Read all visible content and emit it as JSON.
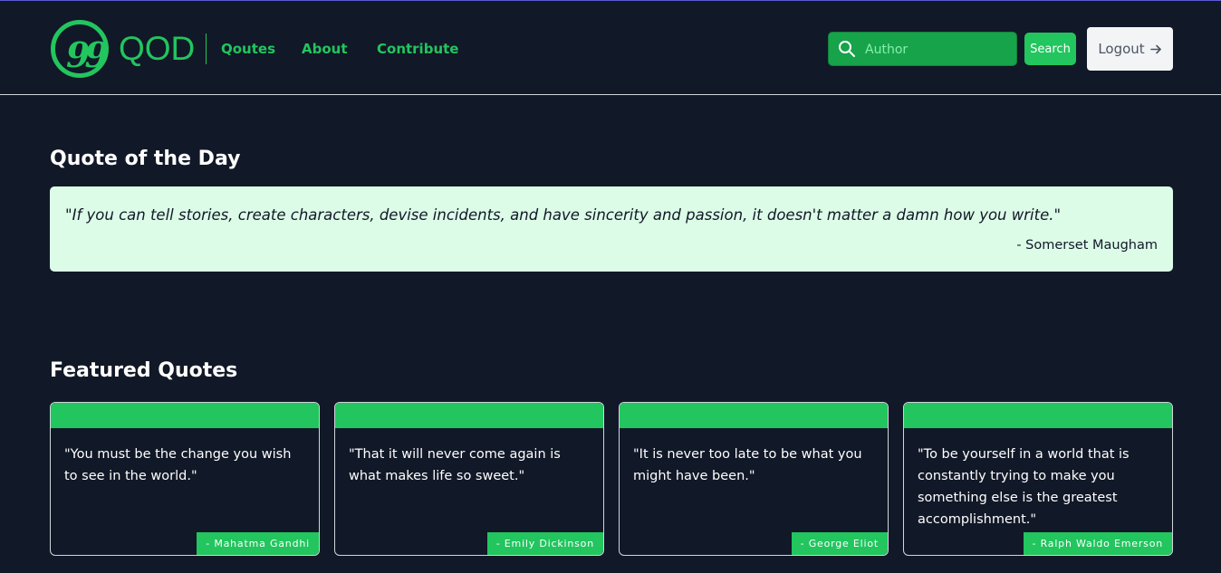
{
  "brand": {
    "name": "QOD",
    "logo_glyph": "99"
  },
  "nav": [
    {
      "label": "Qoutes"
    },
    {
      "label": "About"
    },
    {
      "label": "Contribute"
    }
  ],
  "search": {
    "placeholder": "Author",
    "value": "",
    "button_label": "Search"
  },
  "logout": {
    "label": "Logout",
    "icon": "arrow-right-icon"
  },
  "qotd": {
    "heading": "Quote of the Day",
    "quote": "\"If you can tell stories, create characters, devise incidents, and have sincerity and passion, it doesn't matter a damn how you write.\"",
    "author": "- Somerset Maugham"
  },
  "featured": {
    "heading": "Featured Quotes",
    "cards": [
      {
        "quote": "\"You must be the change you wish to see in the world.\"",
        "author": "- Mahatma Gandhi"
      },
      {
        "quote": "\"That it will never come again is what makes life so sweet.\"",
        "author": "- Emily Dickinson"
      },
      {
        "quote": "\"It is never too late to be what you might have been.\"",
        "author": "- George Eliot"
      },
      {
        "quote": "\"To be yourself in a world that is constantly trying to make you something else is the greatest accomplishment.\"",
        "author": "- Ralph Waldo Emerson"
      }
    ]
  },
  "colors": {
    "background": "#111827",
    "accent": "#22c55e",
    "qotd_background": "#dcfce7"
  }
}
